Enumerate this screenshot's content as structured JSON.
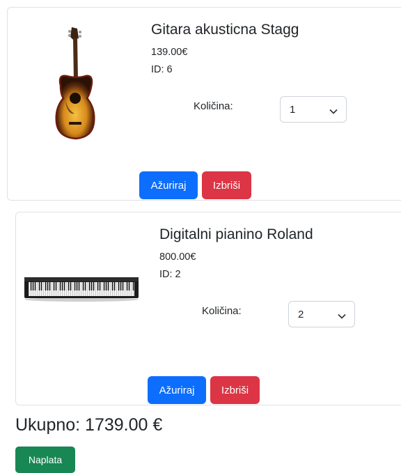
{
  "cart": {
    "items": [
      {
        "image": "acoustic-guitar-sunburst",
        "name": "Gitara akusticna Stagg",
        "price": "139.00€",
        "id_text": "ID: 6",
        "quantity_label": "Količina:",
        "quantity": "1",
        "update_label": "Ažuriraj",
        "delete_label": "Izbriši"
      },
      {
        "image": "digital-piano-black",
        "name": "Digitalni pianino Roland",
        "price": "800.00€",
        "id_text": "ID: 2",
        "quantity_label": "Količina:",
        "quantity": "2",
        "update_label": "Ažuriraj",
        "delete_label": "Izbriši"
      }
    ],
    "total": "Ukupno: 1739.00 €",
    "checkout_label": "Naplata"
  },
  "colors": {
    "primary": "#0d6efd",
    "danger": "#dc3545",
    "success": "#198754",
    "border": "#dee2e6"
  },
  "icons": {
    "select_arrow": "chevron-down-icon"
  }
}
